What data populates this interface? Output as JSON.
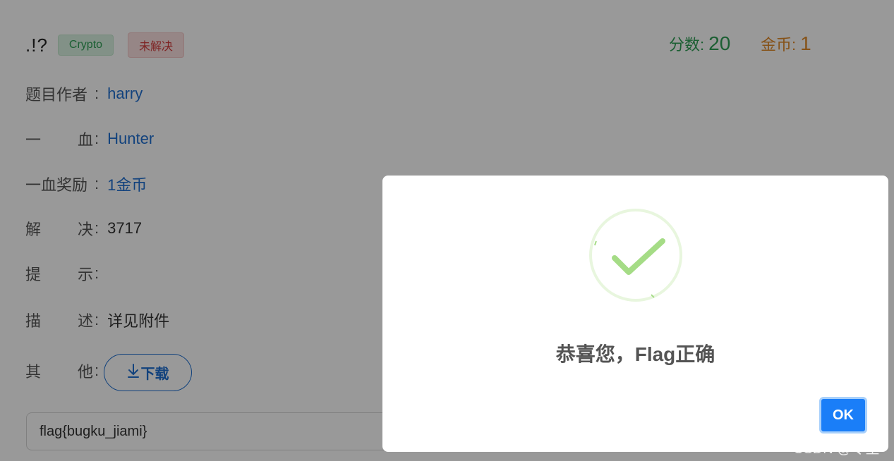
{
  "challenge": {
    "title": ".!?",
    "category_tag": "Crypto",
    "status_tag": "未解决",
    "score_label": "分数:",
    "score_value": "20",
    "coin_label": "金币:",
    "coin_value": "1",
    "info": [
      {
        "label_a": "题目作者",
        "label_b": "",
        "value": "harry"
      },
      {
        "label_a": "一",
        "label_b": "血",
        "value": "Hunter"
      },
      {
        "label_a": "一血奖励",
        "label_b": "",
        "value": "1金币"
      },
      {
        "label_a": "解",
        "label_b": "决",
        "value": "3717"
      },
      {
        "label_a": "提",
        "label_b": "示",
        "value": ""
      },
      {
        "label_a": "描",
        "label_b": "述",
        "value": "详见附件"
      },
      {
        "label_a": "其",
        "label_b": "他",
        "value": ""
      }
    ],
    "colon": ":",
    "download_label": "下载",
    "download_icon": "download-arrow-icon",
    "flag_input_value": "flag{bugku_jiami}"
  },
  "modal": {
    "icon": "success-check-icon",
    "message": "恭喜您，Flag正确",
    "ok_label": "OK"
  },
  "watermark": "CSDN @令笙",
  "colors": {
    "success_green": "#2f9e55",
    "coin_orange": "#e08a2b",
    "link_blue": "#1e6fd0",
    "ok_blue": "#1a7ef8",
    "check_green": "#a5dc86"
  }
}
